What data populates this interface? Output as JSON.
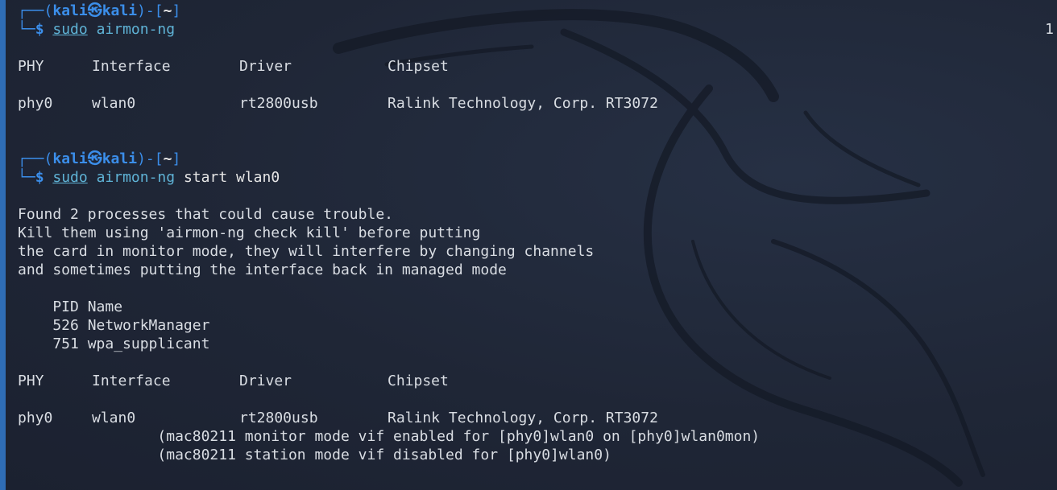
{
  "prompt": {
    "user": "kali",
    "host": "kali",
    "path": "~"
  },
  "right_indicator": "1",
  "cmd1": {
    "sudo": "sudo",
    "program": "airmon-ng",
    "args": ""
  },
  "table1": {
    "headers": [
      "PHY",
      "Interface",
      "Driver",
      "Chipset"
    ],
    "rows": [
      [
        "phy0",
        "wlan0",
        "rt2800usb",
        "Ralink Technology, Corp. RT3072"
      ]
    ]
  },
  "cmd2": {
    "sudo": "sudo",
    "program": "airmon-ng",
    "args": "start wlan0"
  },
  "warning": [
    "Found 2 processes that could cause trouble.",
    "Kill them using 'airmon-ng check kill' before putting",
    "the card in monitor mode, they will interfere by changing channels",
    "and sometimes putting the interface back in managed mode"
  ],
  "processes": {
    "header": "    PID Name",
    "rows": [
      "    526 NetworkManager",
      "    751 wpa_supplicant"
    ]
  },
  "table2": {
    "headers": [
      "PHY",
      "Interface",
      "Driver",
      "Chipset"
    ],
    "rows": [
      [
        "phy0",
        "wlan0",
        "rt2800usb",
        "Ralink Technology, Corp. RT3072"
      ]
    ],
    "notes": [
      "                (mac80211 monitor mode vif enabled for [phy0]wlan0 on [phy0]wlan0mon)",
      "                (mac80211 station mode vif disabled for [phy0]wlan0)"
    ]
  }
}
